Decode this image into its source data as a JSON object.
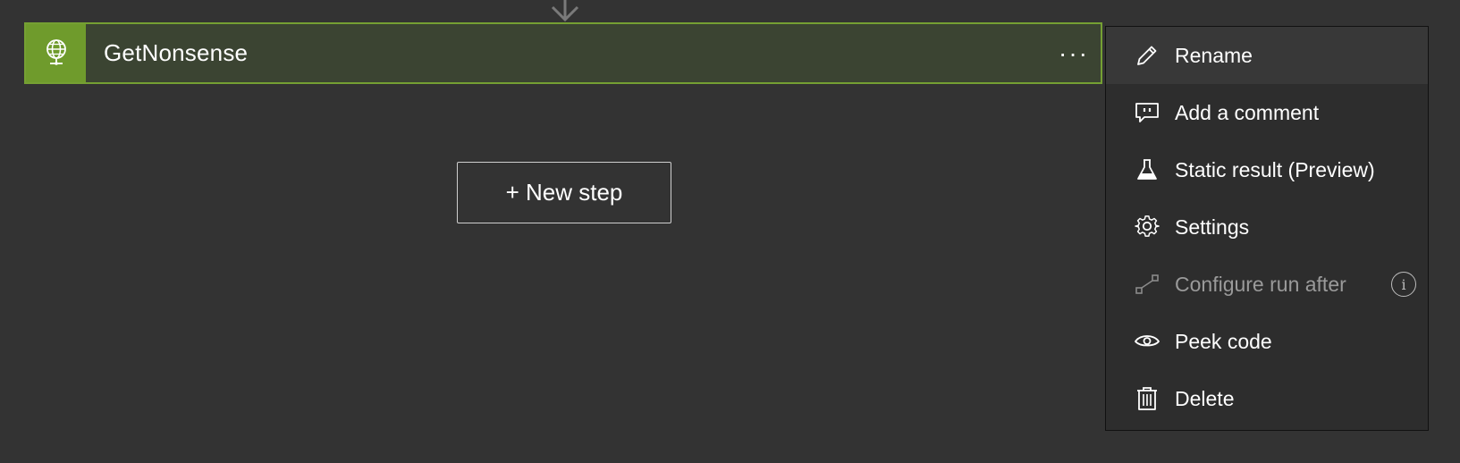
{
  "action_card": {
    "title": "GetNonsense",
    "icon": "globe-icon",
    "more_label": "···",
    "accent_color": "#6f9b2c"
  },
  "new_step": {
    "label": "+ New step"
  },
  "context_menu": {
    "items": [
      {
        "label": "Rename",
        "icon": "pencil-icon"
      },
      {
        "label": "Add a comment",
        "icon": "comment-icon"
      },
      {
        "label": "Static result (Preview)",
        "icon": "flask-icon"
      },
      {
        "label": "Settings",
        "icon": "gear-icon"
      },
      {
        "label": "Configure run after",
        "icon": "run-after-icon",
        "disabled": true,
        "info": "i"
      },
      {
        "label": "Peek code",
        "icon": "eye-icon"
      },
      {
        "label": "Delete",
        "icon": "trash-icon"
      }
    ]
  }
}
